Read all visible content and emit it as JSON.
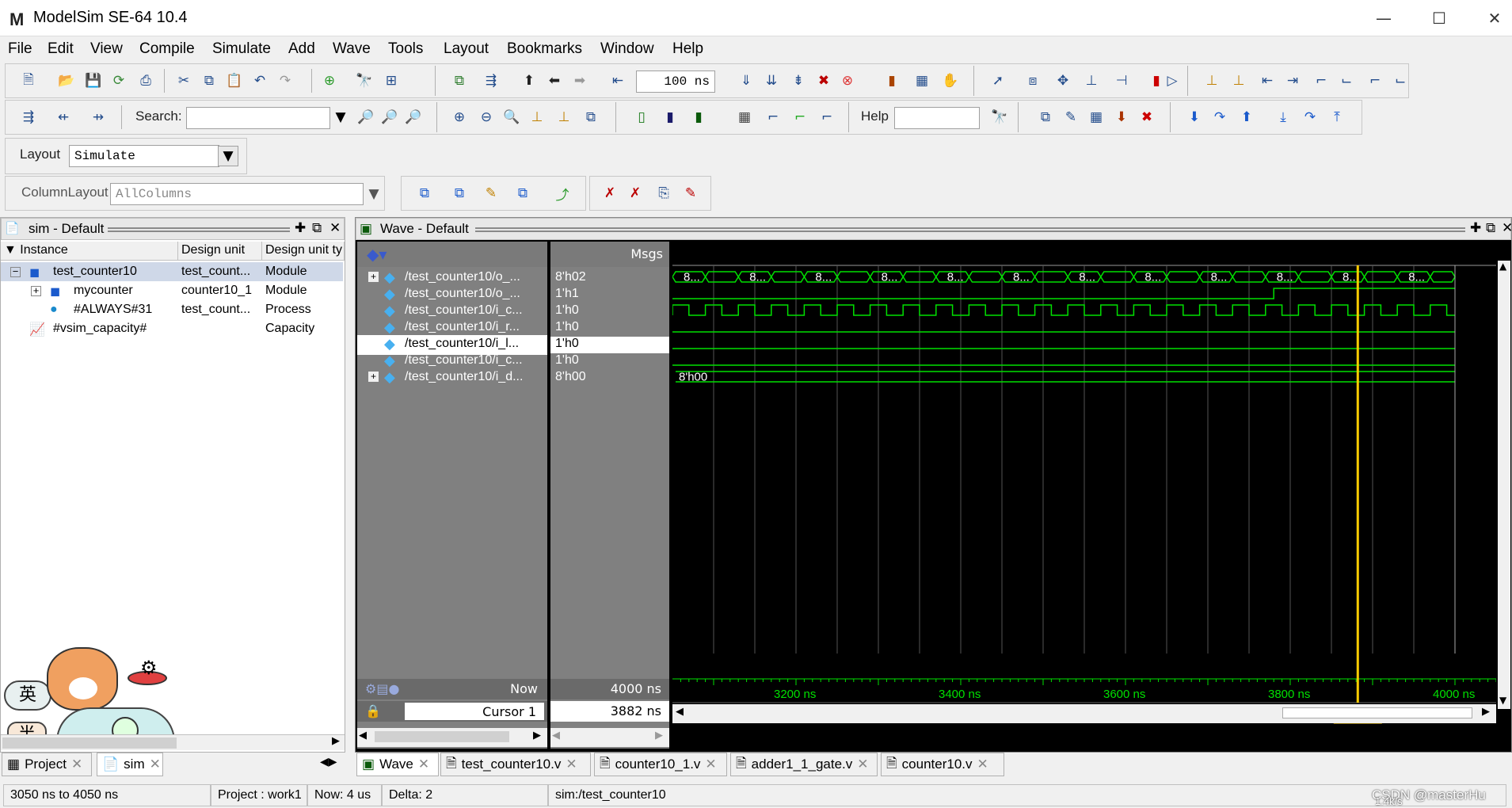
{
  "window": {
    "app_logo": "M",
    "title": "ModelSim SE-64 10.4",
    "minimize_glyph": "—",
    "maximize_glyph": "☐",
    "close_glyph": "✕"
  },
  "menu": [
    "File",
    "Edit",
    "View",
    "Compile",
    "Simulate",
    "Add",
    "Wave",
    "Tools",
    "Layout",
    "Bookmarks",
    "Window",
    "Help"
  ],
  "toolbar": {
    "time_step_value": "100 ns",
    "search_label": "Search:",
    "search_value": "",
    "help_label": "Help",
    "help_value": "",
    "layout_label": "Layout",
    "layout_value": "Simulate",
    "column_layout_label": "ColumnLayout",
    "column_layout_value": "AllColumns"
  },
  "sim_pane": {
    "title": "sim - Default",
    "columns": [
      "Instance",
      "Design unit",
      "Design unit ty"
    ],
    "rows": [
      {
        "instance": "test_counter10",
        "design_unit": "test_count...",
        "type": "Module"
      },
      {
        "instance": "mycounter",
        "design_unit": "counter10_1",
        "type": "Module"
      },
      {
        "instance": "#ALWAYS#31",
        "design_unit": "test_count...",
        "type": "Process"
      },
      {
        "instance": "#vsim_capacity#",
        "design_unit": "",
        "type": "Capacity"
      }
    ],
    "ime_badge": "英",
    "ime_badge2": "半"
  },
  "wave_pane": {
    "title": "Wave - Default",
    "msgs_header": "Msgs",
    "signals": [
      {
        "name": "/test_counter10/o_...",
        "value": "8'h02",
        "expandable": true
      },
      {
        "name": "/test_counter10/o_...",
        "value": "1'h1",
        "expandable": false
      },
      {
        "name": "/test_counter10/i_c...",
        "value": "1'h0",
        "expandable": false
      },
      {
        "name": "/test_counter10/i_r...",
        "value": "1'h0",
        "expandable": false
      },
      {
        "name": "/test_counter10/i_l...",
        "value": "1'h0",
        "expandable": false
      },
      {
        "name": "/test_counter10/i_c...",
        "value": "1'h0",
        "expandable": false
      },
      {
        "name": "/test_counter10/i_d...",
        "value": "8'h00",
        "expandable": true
      }
    ],
    "bus_label": "8...",
    "bus_label_2": "8'h00",
    "now_label": "Now",
    "now_value": "4000 ns",
    "cursor_label": "Cursor 1",
    "cursor_value": "3882 ns",
    "cursor_tag": "3882 ns",
    "time_ticks": [
      "3200 ns",
      "3400 ns",
      "3600 ns",
      "3800 ns",
      "4000 ns"
    ],
    "colors": {
      "wave": "#00e000",
      "cursor": "#ffcc00",
      "bg": "#000000",
      "grid": "#555555"
    }
  },
  "left_tabs": [
    {
      "label": "Project",
      "icon": "project-icon"
    },
    {
      "label": "sim",
      "icon": "sim-icon"
    }
  ],
  "right_tabs": [
    {
      "label": "Wave"
    },
    {
      "label": "test_counter10.v"
    },
    {
      "label": "counter10_1.v"
    },
    {
      "label": "adder1_1_gate.v"
    },
    {
      "label": "counter10.v"
    }
  ],
  "status": {
    "range": "3050 ns to 4050 ns",
    "project": "Project : work1",
    "now": "Now: 4 us",
    "delta": "Delta: 2",
    "context": "sim:/test_counter10",
    "watermark": "CSDN @masterHu",
    "net_speed": "1.4k/s"
  }
}
